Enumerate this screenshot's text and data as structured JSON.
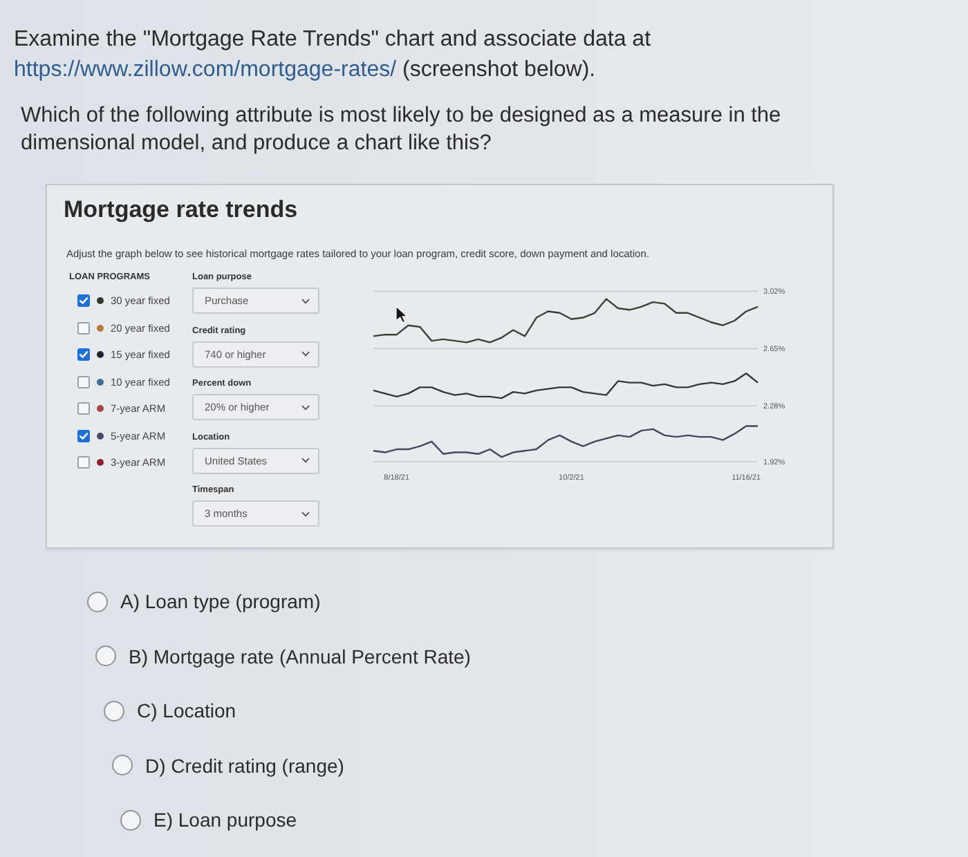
{
  "question": {
    "text_before": "Examine the \"Mortgage Rate Trends\" chart and associate data at",
    "link": "https://www.zillow.com/mortgage-rates/",
    "text_after": "(screenshot below).",
    "prompt": "Which of the following attribute is most likely to be designed as a measure in the dimensional model, and produce a chart like this?"
  },
  "screenshot": {
    "title": "Mortgage rate trends",
    "description": "Adjust the graph below to see historical mortgage rates tailored to your loan program, credit score, down payment and location.",
    "loan_programs": {
      "heading": "LOAN PROGRAMS",
      "items": [
        {
          "label": "30 year fixed",
          "checked": true,
          "color": "#2e3b2a"
        },
        {
          "label": "20 year fixed",
          "checked": false,
          "color": "#b07a3e"
        },
        {
          "label": "15 year fixed",
          "checked": true,
          "color": "#1f2230"
        },
        {
          "label": "10 year fixed",
          "checked": false,
          "color": "#3e6e94"
        },
        {
          "label": "7-year ARM",
          "checked": false,
          "color": "#a3473f"
        },
        {
          "label": "5-year ARM",
          "checked": true,
          "color": "#454a63"
        },
        {
          "label": "3-year ARM",
          "checked": false,
          "color": "#8e2130"
        }
      ]
    },
    "filters": [
      {
        "label": "Loan purpose",
        "value": "Purchase"
      },
      {
        "label": "Credit rating",
        "value": "740 or higher"
      },
      {
        "label": "Percent down",
        "value": "20% or higher"
      },
      {
        "label": "Location",
        "value": "United States"
      },
      {
        "label": "Timespan",
        "value": "3 months"
      }
    ],
    "chart_data": {
      "type": "line",
      "categories": [
        null,
        null,
        "8/18/21",
        null,
        null,
        null,
        null,
        null,
        null,
        null,
        null,
        null,
        null,
        null,
        null,
        null,
        null,
        "10/2/21",
        null,
        null,
        null,
        null,
        null,
        null,
        null,
        null,
        null,
        null,
        null,
        null,
        null,
        null,
        "11/16/21",
        null
      ],
      "series": [
        {
          "color": "#3a4237",
          "values": [
            2.73,
            2.74,
            2.74,
            2.8,
            2.79,
            2.7,
            2.71,
            2.7,
            2.69,
            2.71,
            2.69,
            2.72,
            2.77,
            2.73,
            2.85,
            2.89,
            2.88,
            2.84,
            2.85,
            2.88,
            2.97,
            2.91,
            2.9,
            2.92,
            2.95,
            2.94,
            2.88,
            2.88,
            2.85,
            2.82,
            2.8,
            2.83,
            2.89,
            2.92
          ]
        },
        {
          "color": "#33353f",
          "values": [
            2.38,
            2.36,
            2.34,
            2.36,
            2.4,
            2.4,
            2.37,
            2.35,
            2.36,
            2.34,
            2.34,
            2.33,
            2.37,
            2.36,
            2.38,
            2.39,
            2.4,
            2.4,
            2.37,
            2.36,
            2.35,
            2.44,
            2.43,
            2.43,
            2.41,
            2.42,
            2.4,
            2.4,
            2.42,
            2.43,
            2.42,
            2.44,
            2.49,
            2.43
          ]
        },
        {
          "color": "#43475a",
          "values": [
            1.99,
            1.98,
            2.0,
            2.0,
            2.02,
            2.05,
            1.97,
            1.98,
            1.98,
            1.97,
            2.0,
            1.95,
            1.98,
            1.99,
            2.0,
            2.06,
            2.09,
            2.05,
            2.02,
            2.05,
            2.07,
            2.09,
            2.08,
            2.12,
            2.13,
            2.09,
            2.08,
            2.09,
            2.08,
            2.08,
            2.06,
            2.1,
            2.15,
            2.15
          ]
        }
      ],
      "ylim": [
        1.92,
        3.02
      ],
      "yticks": [
        {
          "value": 3.02,
          "label": "3.02%"
        },
        {
          "value": 2.65,
          "label": "2.65%"
        },
        {
          "value": 2.28,
          "label": "2.28%"
        },
        {
          "value": 1.92,
          "label": "1.92%"
        }
      ]
    }
  },
  "options": [
    {
      "label": "A) Loan type (program)",
      "selected": false
    },
    {
      "label": "B) Mortgage rate (Annual Percent Rate)",
      "selected": false
    },
    {
      "label": "C) Location",
      "selected": false
    },
    {
      "label": "D) Credit rating (range)",
      "selected": false
    },
    {
      "label": "E) Loan purpose",
      "selected": false
    }
  ]
}
